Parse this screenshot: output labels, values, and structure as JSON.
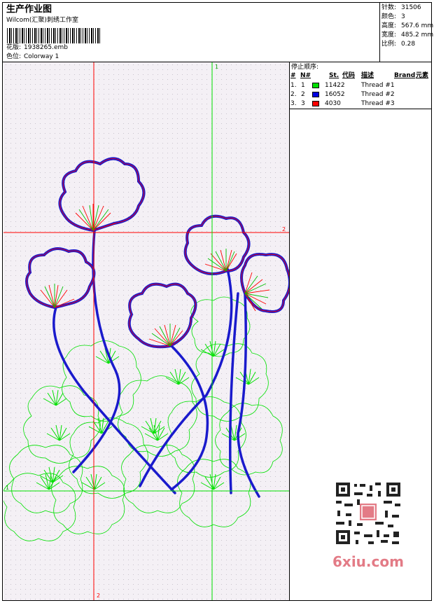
{
  "header": {
    "title": "生产作业图",
    "studio": "Wilcom(汇聚)刺绣工作室",
    "design_label": "花版:",
    "design_value": "1938265.emb",
    "colorway_label": "色位:",
    "colorway_value": "Colorway 1"
  },
  "stats": [
    {
      "label": "针数:",
      "value": "31506"
    },
    {
      "label": "颜色:",
      "value": "3"
    },
    {
      "label": "高度:",
      "value": "567.6 mm"
    },
    {
      "label": "宽度:",
      "value": "485.2 mm"
    },
    {
      "label": "比例:",
      "value": "0.28"
    }
  ],
  "stop_sequence": {
    "title": "停止顺序:",
    "columns": [
      "#",
      "N#",
      "St.",
      "代码",
      "描述",
      "Brand",
      "元素"
    ],
    "rows": [
      {
        "num": "1.",
        "n": "1",
        "color": "#00e000",
        "code": "11422",
        "desc": "Thread #1"
      },
      {
        "num": "2.",
        "n": "2",
        "color": "#0000e0",
        "code": "16052",
        "desc": "Thread #2"
      },
      {
        "num": "3.",
        "n": "3",
        "color": "#ff0000",
        "code": "4030",
        "desc": "Thread #3"
      }
    ]
  },
  "guides": {
    "v_green": "1",
    "h_red": "2",
    "h_green": "1",
    "v_red": "2"
  },
  "watermark": "6xiu.com",
  "colors": {
    "green": "#00e000",
    "blue": "#1a1acc",
    "red": "#ff0000"
  }
}
